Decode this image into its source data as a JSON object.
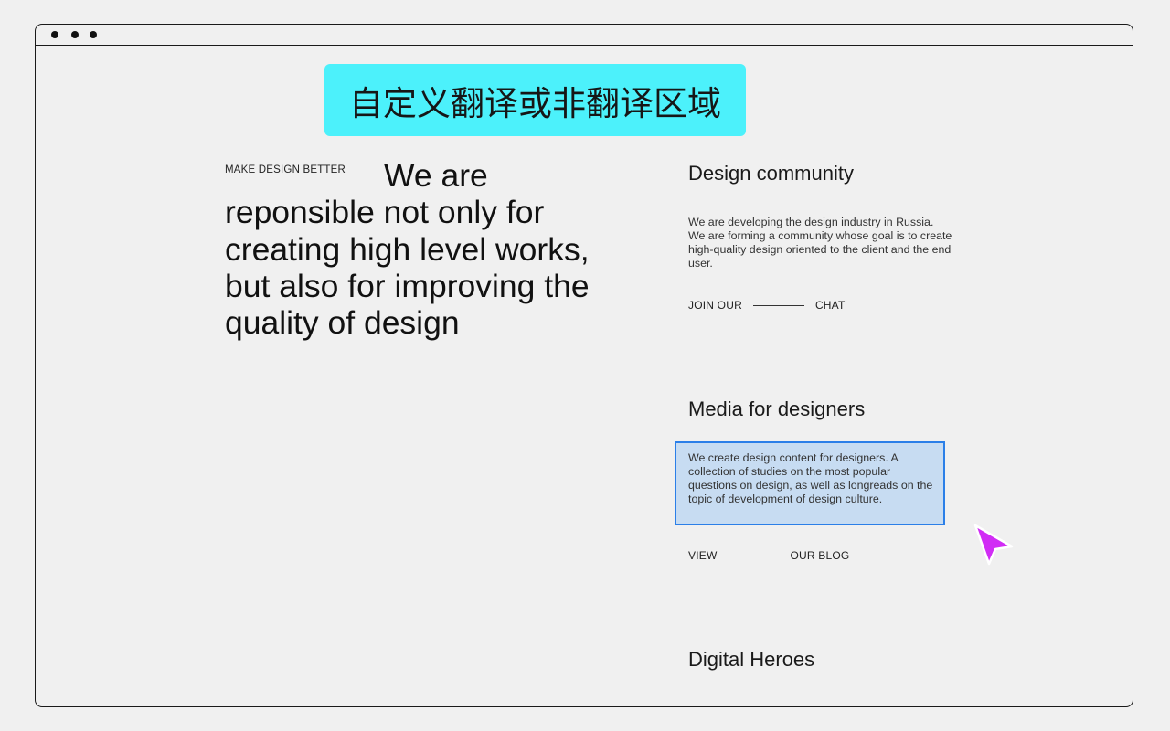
{
  "window": {
    "titlebar_dots": [
      "close",
      "minimize",
      "maximize"
    ]
  },
  "banner": {
    "text": "自定义翻译或非翻译区域",
    "color": "#4cf1fb"
  },
  "hero": {
    "eyebrow": "MAKE DESIGN BETTER",
    "headline": "We are reponsible not only for creating high level works, but also for improving the quality of design"
  },
  "sections": [
    {
      "title": "Design community",
      "body": "We are developing the design industry in Russia. We are forming a community whose goal is to create high-quality design oriented to the client and the end user.",
      "link_left": "JOIN OUR",
      "link_right": "CHAT"
    },
    {
      "title": "Media for designers",
      "body": "We create design content for designers. A collection of studies on the most popular questions on design, as well as longreads on the topic of development of design culture.",
      "link_left": "VIEW",
      "link_right": "OUR BLOG",
      "highlighted": true
    },
    {
      "title": "Digital Heroes"
    }
  ],
  "highlight_color": "#2b7fe8",
  "cursor": {
    "icon": "pointer-arrow-icon",
    "color": "#d12cf5"
  }
}
